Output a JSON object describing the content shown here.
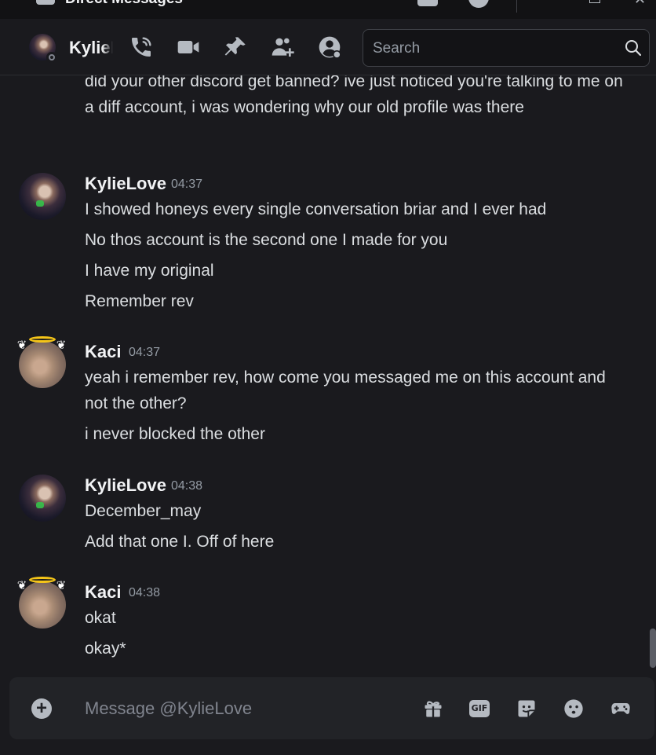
{
  "window": {
    "title": "Direct Messages"
  },
  "header": {
    "username": "KylieLove",
    "search_placeholder": "Search"
  },
  "messages": {
    "continued": "did your other discord get banned? ive just noticed you're talking to me on a diff account, i was wondering why our old profile was there",
    "groups": [
      {
        "author": "KylieLove",
        "time": "04:37",
        "lines": [
          "I showed honeys every single conversation briar and I ever had",
          "No thos account is the second one I made for you",
          "I have my original",
          "Remember rev"
        ]
      },
      {
        "author": "Kaci",
        "time": "04:37",
        "lines": [
          "yeah i remember rev, how come you messaged me on this account and not the other?",
          "i never blocked the other"
        ]
      },
      {
        "author": "KylieLove",
        "time": "04:38",
        "lines": [
          "December_may",
          "Add that one I. Off of here"
        ]
      },
      {
        "author": "Kaci",
        "time": "04:38",
        "lines": [
          "okat",
          "okay*"
        ]
      }
    ]
  },
  "composer": {
    "placeholder": "Message @KylieLove",
    "gif_label": "GIF"
  }
}
